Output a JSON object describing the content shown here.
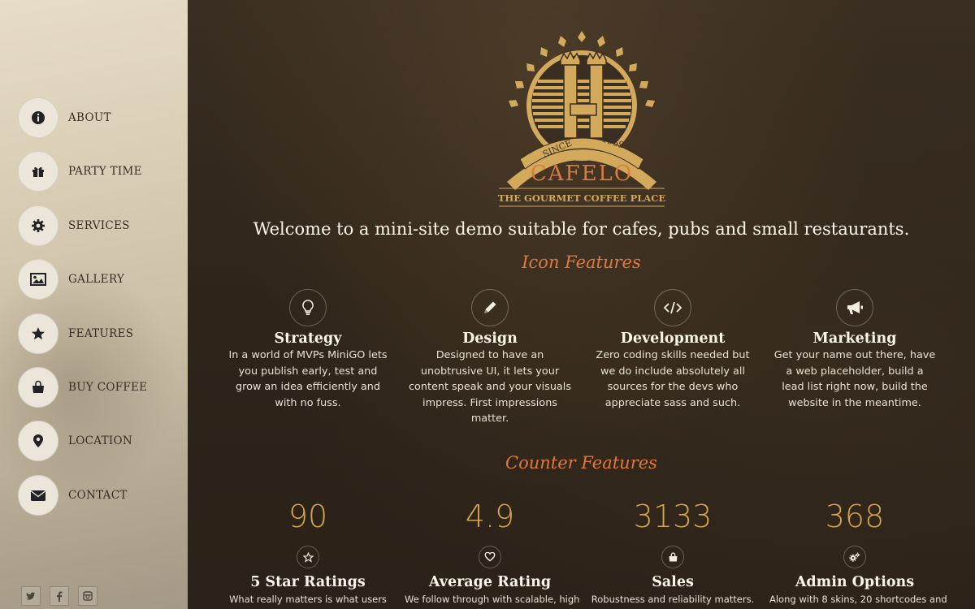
{
  "sidebar": {
    "items": [
      {
        "label": "ABOUT",
        "icon": "info-icon"
      },
      {
        "label": "PARTY TIME",
        "icon": "gift-icon"
      },
      {
        "label": "SERVICES",
        "icon": "gear-icon"
      },
      {
        "label": "GALLERY",
        "icon": "image-icon"
      },
      {
        "label": "FEATURES",
        "icon": "star-icon"
      },
      {
        "label": "BUY COFFEE",
        "icon": "shopping-bag-icon"
      },
      {
        "label": "LOCATION",
        "icon": "map-marker-icon"
      },
      {
        "label": "CONTACT",
        "icon": "envelope-icon"
      }
    ],
    "social": [
      {
        "icon": "twitter-icon",
        "glyph": "🐦"
      },
      {
        "icon": "facebook-icon",
        "glyph": "f"
      },
      {
        "icon": "instagram-icon",
        "glyph": "◘"
      }
    ]
  },
  "logo": {
    "since": "SINCE",
    "year": "1969",
    "letter": "H",
    "name": "CAFELO",
    "tagline": "THE GOURMET COFFEE PLACE"
  },
  "welcome": "Welcome to a mini-site demo suitable for cafes, pubs and small restaurants.",
  "icon_features": {
    "title": "Icon Features",
    "items": [
      {
        "icon": "lightbulb-icon",
        "title": "Strategy",
        "text": "In a world of MVPs MiniGO lets you publish early, test and grow an idea efficiently and with no fuss."
      },
      {
        "icon": "pencil-icon",
        "title": "Design",
        "text": "Designed to have an unobtrusive UI, it lets your content speak and your visuals impress. First impressions matter."
      },
      {
        "icon": "code-icon",
        "title": "Development",
        "text": "Zero coding skills needed but we do include absolutely all sources for the devs who appreciate sass and such."
      },
      {
        "icon": "megaphone-icon",
        "title": "Marketing",
        "text": "Get your name out there, have a web placeholder, build a lead list right now, build the website in the meantime."
      }
    ]
  },
  "counter_features": {
    "title": "Counter Features",
    "items": [
      {
        "value": "90",
        "icon": "star-outline-icon",
        "label": "5 Star Ratings",
        "text": "What really matters is what users"
      },
      {
        "value": "4.9",
        "icon": "heart-outline-icon",
        "label": "Average Rating",
        "text": "We follow through with scalable, high"
      },
      {
        "value": "3133",
        "icon": "shopping-bag-icon",
        "label": "Sales",
        "text": "Robustness and reliability matters."
      },
      {
        "value": "368",
        "icon": "cogs-icon",
        "label": "Admin Options",
        "text": "Along with 8 skins, 20 shortcodes and"
      }
    ]
  },
  "colors": {
    "accent": "#e07a3c",
    "counter": "#d4a64a",
    "logo_gold": "#d3aa5c"
  }
}
